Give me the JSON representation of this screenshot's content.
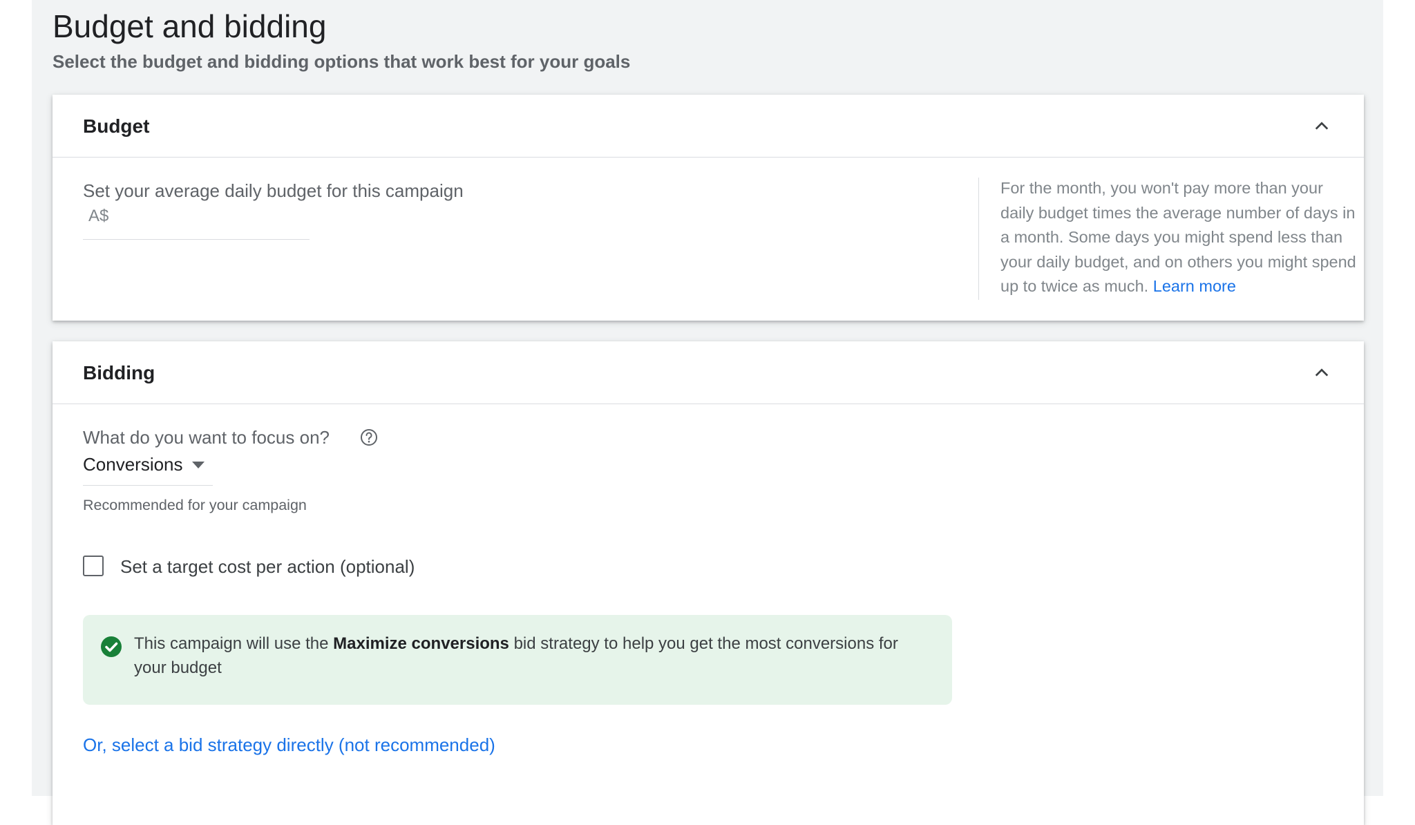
{
  "page": {
    "title": "Budget and bidding",
    "subtitle": "Select the budget and bidding options that work best for your goals"
  },
  "budget": {
    "title": "Budget",
    "prompt": "Set your average daily budget for this campaign",
    "currency": "A$",
    "amount": "",
    "help_text": "For the month, you won't pay more than your daily budget times the average number of days in a month. Some days you might spend less than your daily budget, and on others you might spend up to twice as much.",
    "learn_more": "Learn more"
  },
  "bidding": {
    "title": "Bidding",
    "focus_question": "What do you want to focus on?",
    "focus_value": "Conversions",
    "recommended_note": "Recommended for your campaign",
    "target_cpa_label": "Set a target cost per action (optional)",
    "target_cpa_checked": false,
    "info_prefix": "This campaign will use the ",
    "info_strategy": "Maximize conversions",
    "info_suffix": " bid strategy to help you get the most conversions for your budget",
    "select_strategy_link": "Or, select a bid strategy directly (not recommended)"
  },
  "colors": {
    "accent": "#1a73e8",
    "success": "#188038",
    "success_bg": "#e6f4ea",
    "page_bg": "#f1f3f4"
  },
  "icons": {
    "collapse": "chevron-up-icon",
    "help": "help-circle-icon",
    "dropdown": "caret-down-icon",
    "success": "check-circle-icon"
  }
}
